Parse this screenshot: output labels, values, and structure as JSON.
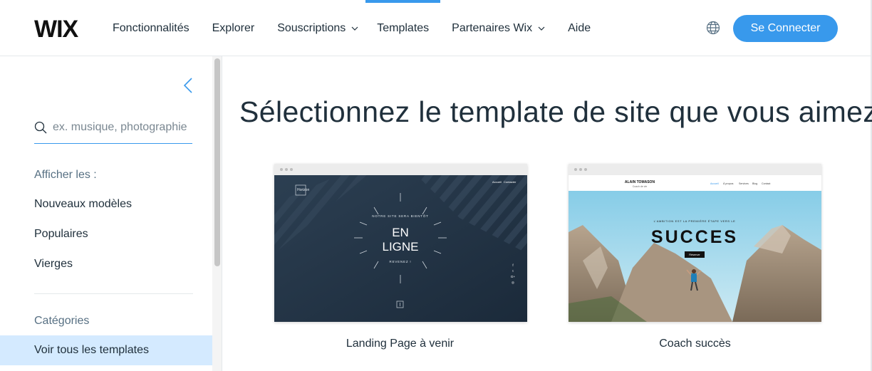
{
  "header": {
    "logo_text": "WIX",
    "nav": [
      {
        "label": "Fonctionnalités",
        "has_dropdown": false
      },
      {
        "label": "Explorer",
        "has_dropdown": false
      },
      {
        "label": "Souscriptions",
        "has_dropdown": true
      },
      {
        "label": "Templates",
        "has_dropdown": false,
        "active": true
      },
      {
        "label": "Partenaires Wix",
        "has_dropdown": true
      },
      {
        "label": "Aide",
        "has_dropdown": false
      }
    ],
    "language_icon": "globe-icon",
    "connect_label": "Se Connecter"
  },
  "sidebar": {
    "collapse_icon": "chevron-left-icon",
    "search": {
      "placeholder": "ex. musique, photographie",
      "value": ""
    },
    "show_label": "Afficher les :",
    "filters": [
      "Nouveaux modèles",
      "Populaires",
      "Vierges"
    ],
    "categories_label": "Catégories",
    "all_templates_label": "Voir tous les templates"
  },
  "main": {
    "title": "Sélectionnez le template de site que vous aimez",
    "templates": [
      {
        "name": "Landing Page à venir",
        "preview": {
          "brand": "Horizon",
          "nav": [
            "Accueil",
            "Contacter"
          ],
          "tagline": "NOTRE SITE SERA BIENTÔT",
          "headline_1": "EN",
          "headline_2": "LIGNE",
          "sub": "REVENEZ !",
          "social": [
            "f",
            "t",
            "G+",
            "◎"
          ]
        }
      },
      {
        "name": "Coach succès",
        "preview": {
          "brand": "ALAIN TOMASON",
          "brand_sub": "Coach de vie",
          "nav": [
            "Accueil",
            "À propos",
            "Services",
            "Blog",
            "Contact"
          ],
          "tagline": "L'AMBITION EST LA PREMIÈRE ÉTAPE VERS LE",
          "headline": "SUCCES",
          "button": "Réserver"
        }
      }
    ]
  },
  "colors": {
    "accent": "#3899ec",
    "selected_bg": "#d4eaff",
    "text": "#20303c"
  }
}
